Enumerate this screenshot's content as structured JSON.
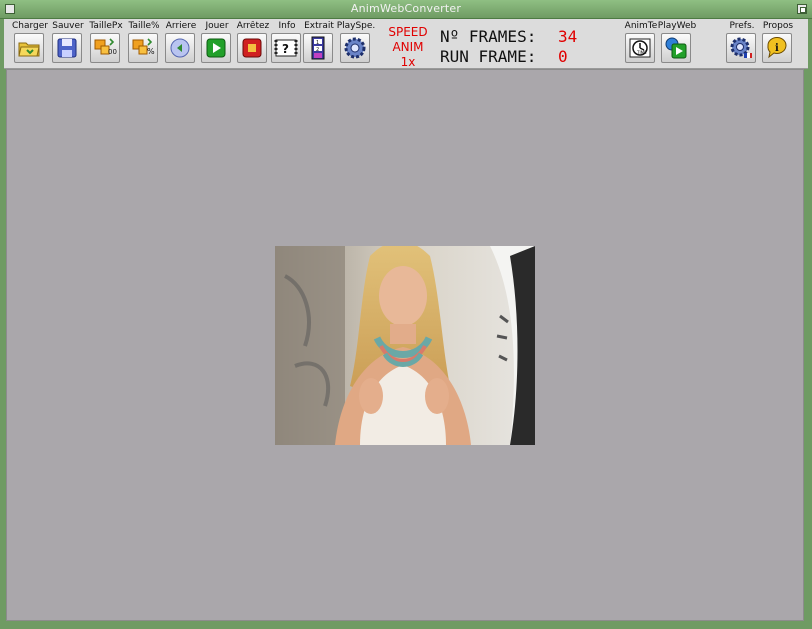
{
  "window": {
    "title": "AnimWebConverter"
  },
  "toolbar": {
    "buttons": [
      {
        "id": "charger",
        "label": "Charger",
        "icon": "folder-open-icon"
      },
      {
        "id": "sauver",
        "label": "Sauver",
        "icon": "save-disk-icon"
      },
      {
        "id": "taillepx",
        "label": "TaillePx",
        "icon": "resize-pixels-icon"
      },
      {
        "id": "taillepct",
        "label": "Taille%",
        "icon": "resize-percent-icon"
      },
      {
        "id": "arriere",
        "label": "Arriere",
        "icon": "back-arrow-icon"
      },
      {
        "id": "jouer",
        "label": "Jouer",
        "icon": "play-icon"
      },
      {
        "id": "arretez",
        "label": "Arrêtez",
        "icon": "stop-icon"
      },
      {
        "id": "info",
        "label": "Info",
        "icon": "info-question-icon"
      },
      {
        "id": "extrait",
        "label": "Extrait",
        "icon": "extract-frames-icon"
      },
      {
        "id": "playspe",
        "label": "PlaySpe.",
        "icon": "gear-icon"
      },
      {
        "id": "animte",
        "label": "AnimTe",
        "icon": "clock-time-icon"
      },
      {
        "id": "playweb",
        "label": "PlayWeb",
        "icon": "web-play-icon"
      },
      {
        "id": "prefs",
        "label": "Prefs.",
        "icon": "gear-flag-icon"
      },
      {
        "id": "propos",
        "label": "Propos",
        "icon": "about-info-icon"
      }
    ]
  },
  "speed": {
    "line1": "SPEED",
    "line2": "ANIM",
    "line3": "1x"
  },
  "stats": {
    "frames_label": "Nº FRAMES:",
    "frames_value": "34",
    "run_label": "RUN FRAME:",
    "run_value": "0"
  },
  "colors": {
    "accent_red": "#e00000",
    "canvas_bg": "#aaa7ab",
    "window_green": "#6f9b63"
  }
}
